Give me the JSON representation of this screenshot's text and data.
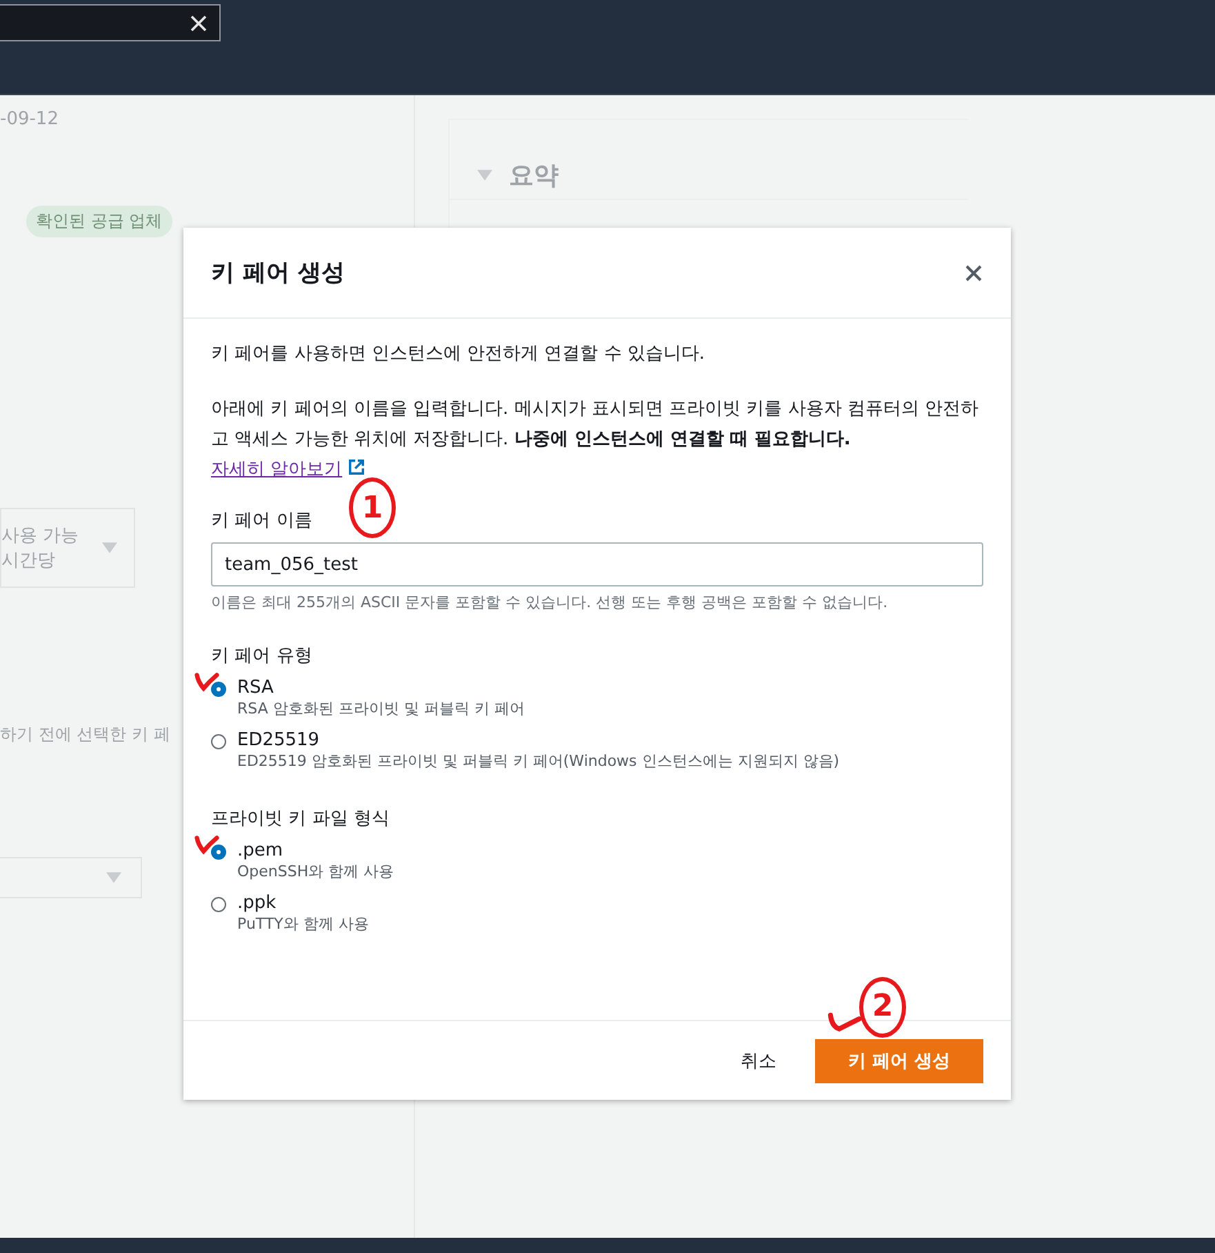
{
  "background": {
    "date": "-09-12",
    "badge": "확인된 공급 업체",
    "summary_title": "요약",
    "dropdown_line_1": "사용 가능",
    "dropdown_line_2": "시간당",
    "note": "하기 전에 선택한 키 페"
  },
  "modal": {
    "title": "키 페어 생성",
    "description": "키 페어를 사용하면 인스턴스에 안전하게 연결할 수 있습니다.",
    "instructions": "아래에 키 페어의 이름을 입력합니다. 메시지가 표시되면 프라이빗 키를 사용자 컴퓨터의 안전하고 액세스 가능한 위치에 저장합니다. **나중에 인스턴스에 연결할 때 필요합니다.**",
    "link": "자세히 알아보기",
    "name_field": {
      "label": "키 페어 이름",
      "value": "team_056_test",
      "hint": "이름은 최대 255개의 ASCII 문자를 포함할 수 있습니다. 선행 또는 후행 공백은 포함할 수 없습니다."
    },
    "groups": [
      {
        "label": "키 페어 유형",
        "options": [
          {
            "label": "RSA",
            "description": "RSA 암호화된 프라이빗 및 퍼블릭 키 페어",
            "selected": true
          },
          {
            "label": "ED25519",
            "description": "ED25519 암호화된 프라이빗 및 퍼블릭 키 페어(Windows 인스턴스에는 지원되지 않음)",
            "selected": false
          }
        ]
      },
      {
        "label": "프라이빗 키 파일 형식",
        "options": [
          {
            "label": ".pem",
            "description": "OpenSSH와 함께 사용",
            "selected": true
          },
          {
            "label": ".ppk",
            "description": "PuTTY와 함께 사용",
            "selected": false
          }
        ]
      }
    ],
    "cancel_button": "취소",
    "create_button": "키 페어 생성"
  },
  "annotations": {
    "field_number": "1",
    "button_number": "2"
  }
}
